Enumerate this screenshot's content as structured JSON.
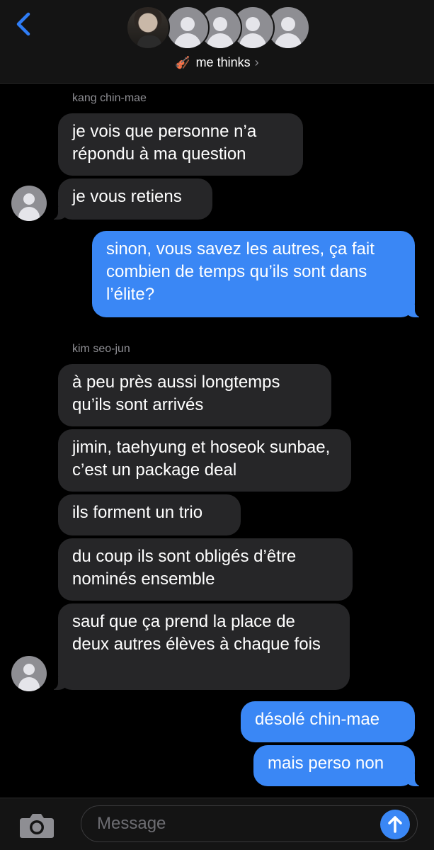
{
  "header": {
    "back_icon": "chevron-left-icon",
    "group_emoji": "🎻",
    "group_name": "me thinks",
    "chevron": "›"
  },
  "messages": [
    {
      "sender": "kang chin-mae"
    },
    {
      "text": "je vois que personne n’a répondu à ma question",
      "direction": "incoming"
    },
    {
      "text": "je vous retiens",
      "direction": "incoming"
    },
    {
      "text": "sinon, vous savez les autres, ça fait combien de temps qu’ils sont dans l’élite?",
      "direction": "outgoing"
    },
    {
      "sender": "kim seo-jun"
    },
    {
      "text": "à peu près aussi longtemps qu’ils sont arrivés",
      "direction": "incoming"
    },
    {
      "text": "jimin, taehyung et hoseok sunbae, c’est un package deal",
      "direction": "incoming"
    },
    {
      "text": "ils forment un trio",
      "direction": "incoming"
    },
    {
      "text": "du coup ils sont obligés d’être nominés ensemble",
      "direction": "incoming"
    },
    {
      "text": "sauf que ça prend la place de deux autres élèves à chaque fois",
      "direction": "incoming"
    },
    {
      "text": "désolé chin-mae",
      "direction": "outgoing"
    },
    {
      "text": "mais perso non",
      "direction": "outgoing"
    }
  ],
  "composer": {
    "placeholder": "Message",
    "camera_icon": "camera-icon",
    "send_icon": "arrow-up-icon"
  },
  "colors": {
    "background": "#000000",
    "bar": "#141414",
    "incoming_bubble": "#262628",
    "outgoing_bubble": "#3a87f5",
    "accent": "#2f7df6",
    "secondary_text": "#8e8e93"
  }
}
